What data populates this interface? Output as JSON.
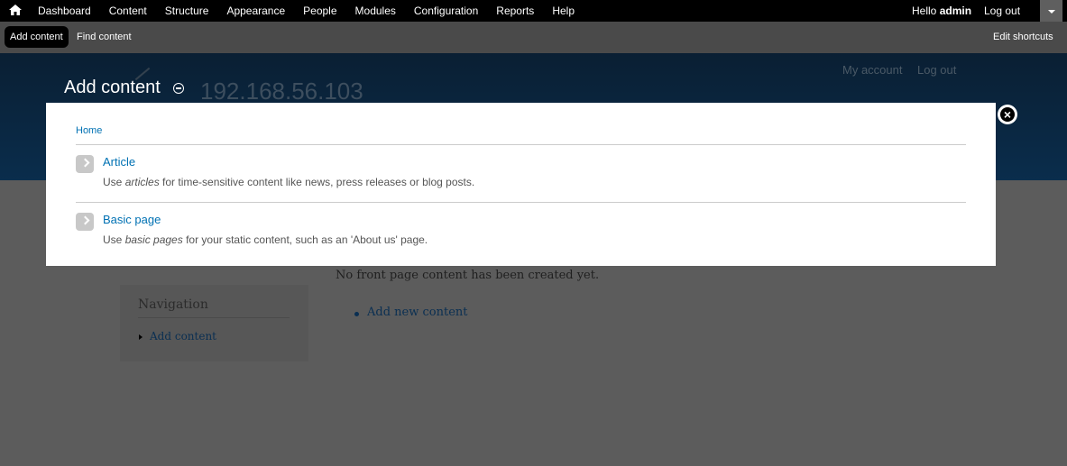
{
  "toolbar": {
    "menu": [
      "Dashboard",
      "Content",
      "Structure",
      "Appearance",
      "People",
      "Modules",
      "Configuration",
      "Reports",
      "Help"
    ],
    "greeting": "Hello ",
    "username": "admin",
    "logout": "Log out"
  },
  "shortcuts": {
    "add_content": "Add content",
    "find_content": "Find content",
    "edit_shortcuts": "Edit shortcuts"
  },
  "header": {
    "page_title": "Add content",
    "site_name": "192.168.56.103",
    "my_account": "My account",
    "logout": "Log out"
  },
  "overlay": {
    "breadcrumb": "Home",
    "items": [
      {
        "title": "Article",
        "desc_prefix": "Use ",
        "desc_em": "articles",
        "desc_suffix": " for time-sensitive content like news, press releases or blog posts."
      },
      {
        "title": "Basic page",
        "desc_prefix": "Use ",
        "desc_em": "basic pages",
        "desc_suffix": " for your static content, such as an 'About us' page."
      }
    ]
  },
  "page": {
    "empty_message": "No front page content has been created yet.",
    "add_new_content": "Add new content",
    "navigation_title": "Navigation",
    "nav_add_content": "Add content"
  },
  "colors": {
    "link": "#0071b3",
    "toolbar_bg": "#000000",
    "overlay_bg": "#ffffff"
  }
}
